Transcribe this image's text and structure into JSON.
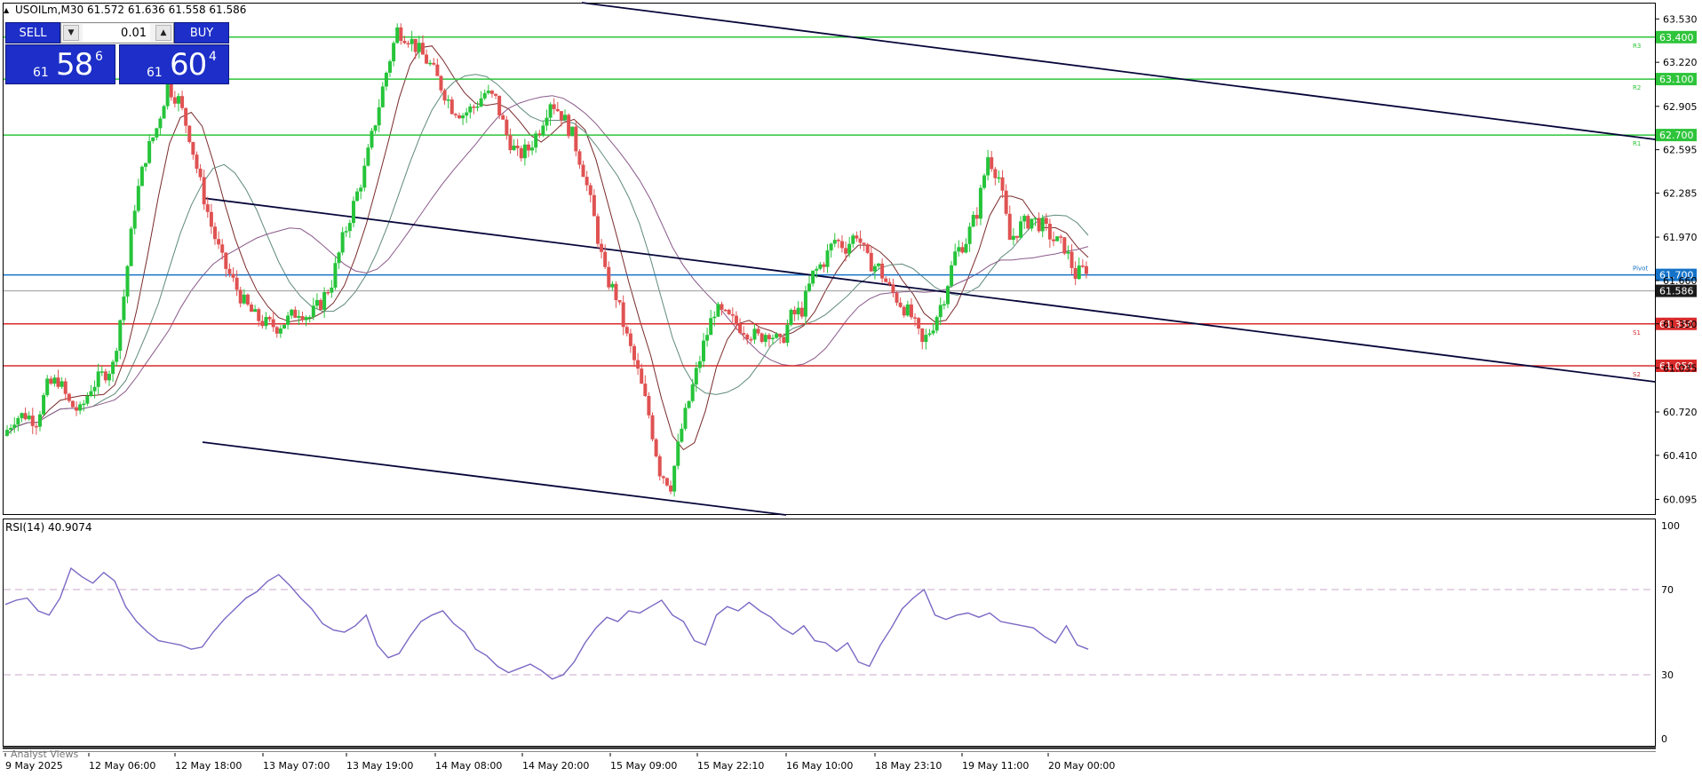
{
  "header": {
    "symbol": "USOILm,M30",
    "ohlc": "61.572 61.636 61.558 61.586"
  },
  "trade_panel": {
    "sell_label": "SELL",
    "buy_label": "BUY",
    "lot_value": "0.01",
    "sell_price": {
      "prefix": "61",
      "big": "58",
      "sup": "6"
    },
    "buy_price": {
      "prefix": "61",
      "big": "60",
      "sup": "4"
    }
  },
  "rsi": {
    "label": "RSI(14) 40.9074",
    "levels": [
      "100",
      "70",
      "30",
      "0"
    ]
  },
  "bottom_tab": "Analyst Views",
  "colors": {
    "resistance": "#2ec43a",
    "support": "#d92b2b",
    "pivot": "#1473c8",
    "bull": "#26c43a",
    "bear": "#e05252",
    "rsi_line": "#7b67c4",
    "trendline": "#06063a"
  },
  "chart_data": {
    "type": "candlestick",
    "y_ticks": [
      "63.530",
      "63.220",
      "62.905",
      "62.595",
      "62.285",
      "61.970",
      "61.660",
      "61.350",
      "61.035",
      "60.720",
      "60.410",
      "60.095"
    ],
    "ylim": [
      59.99,
      63.64
    ],
    "x_ticks": [
      "9 May 2025",
      "12 May 06:00",
      "12 May 18:00",
      "13 May 07:00",
      "13 May 19:00",
      "14 May 08:00",
      "14 May 20:00",
      "15 May 09:00",
      "15 May 22:10",
      "16 May 10:00",
      "18 May 23:10",
      "19 May 11:00",
      "20 May 00:00"
    ],
    "level_lines": [
      {
        "value": 63.4,
        "label": "63.400",
        "tag": "R3",
        "kind": "resistance"
      },
      {
        "value": 63.1,
        "label": "63.100",
        "tag": "R2",
        "kind": "resistance"
      },
      {
        "value": 62.7,
        "label": "62.700",
        "tag": "R1",
        "kind": "resistance"
      },
      {
        "value": 61.7,
        "label": "61.700",
        "tag": "Pivot",
        "kind": "pivot"
      },
      {
        "value": 61.35,
        "label": "61.350",
        "tag": "S1",
        "kind": "support"
      },
      {
        "value": 61.05,
        "label": "61.050",
        "tag": "S2",
        "kind": "support"
      }
    ],
    "current_price": {
      "value": 61.586,
      "label": "61.586"
    },
    "closes": [
      60.55,
      60.68,
      60.7,
      60.66,
      60.9,
      60.95,
      60.78,
      60.72,
      60.9,
      60.98,
      61.05,
      61.55,
      62.2,
      62.55,
      62.75,
      63.05,
      62.95,
      62.7,
      62.35,
      62.05,
      61.8,
      61.65,
      61.5,
      61.4,
      61.35,
      61.33,
      61.38,
      61.45,
      61.4,
      61.5,
      61.65,
      61.95,
      62.2,
      62.45,
      62.8,
      63.15,
      63.45,
      63.4,
      63.3,
      63.2,
      63.05,
      62.9,
      62.85,
      62.9,
      63.0,
      62.95,
      62.7,
      62.55,
      62.6,
      62.75,
      62.95,
      62.85,
      62.7,
      62.45,
      62.1,
      61.7,
      61.55,
      61.25,
      61.0,
      60.7,
      60.3,
      60.2,
      60.6,
      60.9,
      61.2,
      61.45,
      61.4,
      61.35,
      61.3,
      61.25,
      61.3,
      61.2,
      61.4,
      61.45,
      61.7,
      61.8,
      61.95,
      61.9,
      62.0,
      61.8,
      61.75,
      61.6,
      61.5,
      61.4,
      61.2,
      61.35,
      61.55,
      61.85,
      61.95,
      62.15,
      62.55,
      62.4,
      61.95,
      62.05,
      62.1,
      62.05,
      61.95,
      61.9,
      61.7,
      61.75
    ],
    "rsi_values": [
      63,
      65,
      66,
      60,
      58,
      66,
      80,
      76,
      73,
      78,
      74,
      62,
      55,
      50,
      46,
      45,
      44,
      42,
      43,
      50,
      56,
      61,
      66,
      69,
      74,
      77,
      72,
      66,
      61,
      54,
      51,
      50,
      53,
      58,
      44,
      38,
      40,
      48,
      55,
      58,
      60,
      54,
      50,
      42,
      39,
      34,
      31,
      33,
      35,
      32,
      28,
      30,
      36,
      45,
      52,
      57,
      55,
      60,
      59,
      62,
      65,
      58,
      55,
      46,
      44,
      58,
      62,
      60,
      64,
      60,
      57,
      52,
      49,
      53,
      46,
      45,
      41,
      45,
      36,
      34,
      44,
      52,
      61,
      66,
      70,
      58,
      56,
      58,
      59,
      57,
      59,
      55,
      54,
      53,
      52,
      48,
      45,
      53,
      44,
      42
    ],
    "rsi_ylim": [
      0,
      100
    ],
    "rsi_levels": [
      70,
      30
    ]
  }
}
